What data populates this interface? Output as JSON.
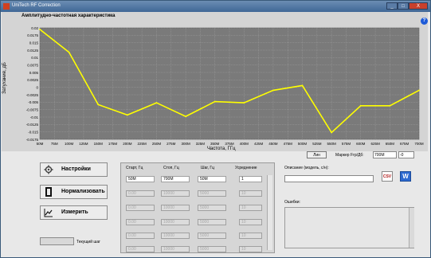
{
  "window": {
    "title": "UniTech RF Correction",
    "min": "_",
    "max": "□",
    "close": "X"
  },
  "chart": {
    "title": "Амплитудно-частотная характеристика",
    "help": "?",
    "xlabel": "Частота, ГГц",
    "ylabel": "Затухание, дБ"
  },
  "chart_data": {
    "type": "line",
    "xlabel": "Частота, ГГц",
    "ylabel": "Затухание, дБ",
    "x_ticks": [
      "50M",
      "75M",
      "100M",
      "125M",
      "150M",
      "175M",
      "200M",
      "225M",
      "250M",
      "275M",
      "300M",
      "325M",
      "350M",
      "375M",
      "400M",
      "425M",
      "450M",
      "475M",
      "500M",
      "525M",
      "550M",
      "575M",
      "600M",
      "625M",
      "650M",
      "675M",
      "700M"
    ],
    "y_ticks": [
      "0.02",
      "0.0175",
      "0.015",
      "0.0125",
      "0.01",
      "0.0075",
      "0.005",
      "0.0025",
      "0",
      "-0.0025",
      "-0.005",
      "-0.0075",
      "-0.01",
      "-0.0125",
      "-0.015",
      "-0.0175"
    ],
    "ylim": [
      -0.0175,
      0.02
    ],
    "xlim": [
      50,
      700
    ],
    "series": [
      {
        "color": "#ffff00",
        "x": [
          50,
          100,
          150,
          200,
          250,
          300,
          350,
          400,
          450,
          500,
          550,
          600,
          650,
          700
        ],
        "y": [
          0.0195,
          0.0118,
          -0.0058,
          -0.0093,
          -0.0052,
          -0.0098,
          -0.0048,
          -0.0052,
          -0.001,
          0.0006,
          -0.0152,
          -0.0062,
          -0.0062,
          -0.001
        ]
      }
    ],
    "plot_bg": "#7a7a7a",
    "grid": true
  },
  "marker": {
    "lin_label": "Лин",
    "label": "Маркер Fгр/Дб:",
    "freq": "700M",
    "value": "-0"
  },
  "buttons": {
    "settings": "Настройки",
    "normalize": "Нормализовать",
    "measure": "Измерить"
  },
  "step_label": "Текущий шаг",
  "table": {
    "headers": [
      "Старт, Гц",
      "Стоп, Гц",
      "Шаг, Гц",
      "Усреднение"
    ],
    "rows": [
      [
        "50M",
        "700M",
        "50M",
        "1"
      ],
      [
        "0.00",
        "10000",
        "5000",
        "10"
      ],
      [
        "0.00",
        "10000",
        "5000",
        "10"
      ],
      [
        "0.00",
        "10000",
        "5000",
        "10"
      ],
      [
        "0.00",
        "10000",
        "5000",
        "10"
      ],
      [
        "0.00",
        "10000",
        "5000",
        "10"
      ]
    ]
  },
  "description": {
    "label": "Описание (модель, с/н):",
    "value": ""
  },
  "csv_label": "CSV",
  "word_label": "W",
  "errors_label": "Ошибки:"
}
